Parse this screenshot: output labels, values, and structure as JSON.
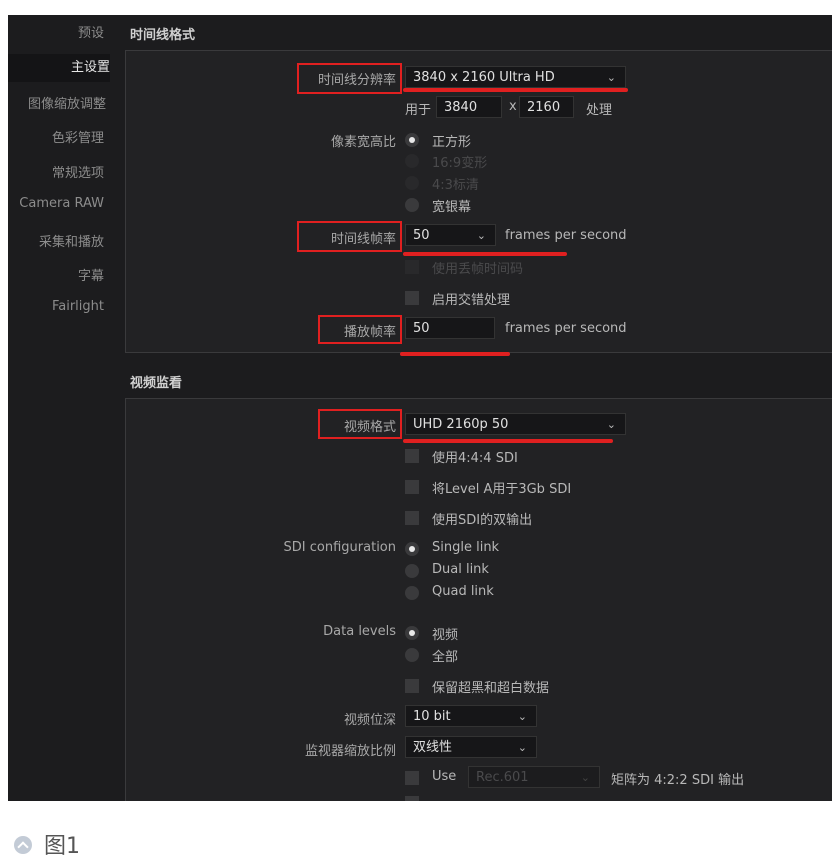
{
  "sidebar": {
    "items": [
      {
        "label": "预设"
      },
      {
        "label": "主设置"
      },
      {
        "label": "图像缩放调整"
      },
      {
        "label": "色彩管理"
      },
      {
        "label": "常规选项"
      },
      {
        "label": "Camera RAW"
      },
      {
        "label": "采集和播放"
      },
      {
        "label": "字幕"
      },
      {
        "label": "Fairlight"
      }
    ],
    "active_index": 1
  },
  "timeline_format": {
    "title": "时间线格式",
    "resolution_label": "时间线分辨率",
    "resolution_value": "3840 x 2160 Ultra HD",
    "use_label": "用于",
    "width": "3840",
    "x_label": "x",
    "height": "2160",
    "process_label": "处理",
    "pixel_aspect_label": "像素宽高比",
    "pixel_aspect_options": [
      "正方形",
      "16:9变形",
      "4:3标清",
      "宽银幕"
    ],
    "framerate_label": "时间线帧率",
    "framerate_value": "50",
    "fps_unit": "frames per second",
    "drop_frame_label": "使用丢帧时间码",
    "interlace_label": "启用交错处理",
    "playback_label": "播放帧率",
    "playback_value": "50",
    "playback_unit": "frames per second"
  },
  "video_monitor": {
    "title": "视频监看",
    "format_label": "视频格式",
    "format_value": "UHD 2160p 50",
    "sdi444_label": "使用4:4:4 SDI",
    "levela_label": "将Level A用于3Gb SDI",
    "dual_output_label": "使用SDI的双输出",
    "sdi_config_label": "SDI configuration",
    "sdi_options": [
      "Single link",
      "Dual link",
      "Quad link"
    ],
    "data_levels_label": "Data levels",
    "data_level_options": [
      "视频",
      "全部"
    ],
    "retain_label": "保留超黑和超白数据",
    "bit_depth_label": "视频位深",
    "bit_depth_value": "10 bit",
    "scaling_label": "监视器缩放比例",
    "scaling_value": "双线性",
    "use_label": "Use",
    "matrix_value": "Rec.601",
    "matrix_suffix": "矩阵为 4:2:2 SDI 输出"
  },
  "caption": {
    "text": "图1"
  },
  "colors": {
    "highlight": "#e02020",
    "background": "#1c1c1e",
    "panel": "#222224"
  },
  "icons": [
    "chevron-down-icon",
    "up-arrow-circle-icon"
  ]
}
